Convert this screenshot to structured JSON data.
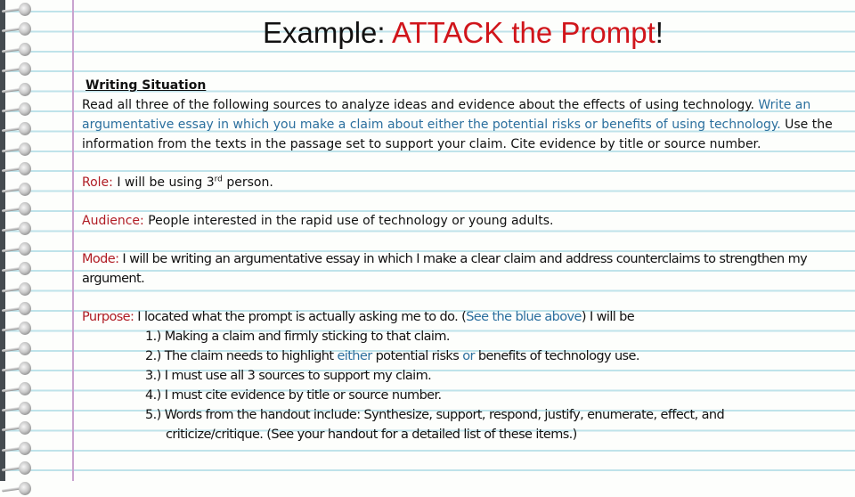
{
  "title": {
    "prefix": "Example: ",
    "highlight": "ATTACK the Prompt",
    "suffix": "!"
  },
  "colors": {
    "title_highlight": "#d0151b",
    "label": "#b01c24",
    "blue_text": "#2b6f9e",
    "ruled_line": "#bfe3ea",
    "margin_line": "#c9a3cf"
  },
  "writing_situation": {
    "heading": "Writing Situation",
    "text_1": "Read all three of the following sources to analyze ideas and evidence about the effects of using technology. ",
    "text_blue": "Write an argumentative essay in which you make a claim about either the potential risks or benefits of using technology.",
    "text_2": " Use the information from the texts in the passage set to support your claim. Cite evidence by title or source number."
  },
  "role": {
    "label": "Role:",
    "text_before": " I will be using 3",
    "superscript": "rd",
    "text_after": " person."
  },
  "audience": {
    "label": "Audience:",
    "text": " People interested in the rapid use of technology or young adults."
  },
  "mode": {
    "label": "Mode:",
    "text": " I will be writing an argumentative essay in which I make a clear claim and address counterclaims to strengthen my argument."
  },
  "purpose": {
    "label": "Purpose:",
    "text_1": " I located what the prompt is actually asking me to do. (",
    "text_blue": "See the blue above",
    "text_2": ") I will be",
    "items": [
      "1.) Making a claim and firmly sticking to that claim.",
      {
        "a": "2.) The claim needs to highlight ",
        "b": "either",
        "c": " potential risks ",
        "d": "or",
        "e": " benefits of technology use."
      },
      "3.) I must use all 3 sources to support my claim.",
      "4.) I must cite evidence by title or source number.",
      "5.) Words from the handout include: Synthesize, support, respond, justify, enumerate, effect, and",
      "criticize/critique. (See your handout for a detailed list of these items.)"
    ]
  }
}
